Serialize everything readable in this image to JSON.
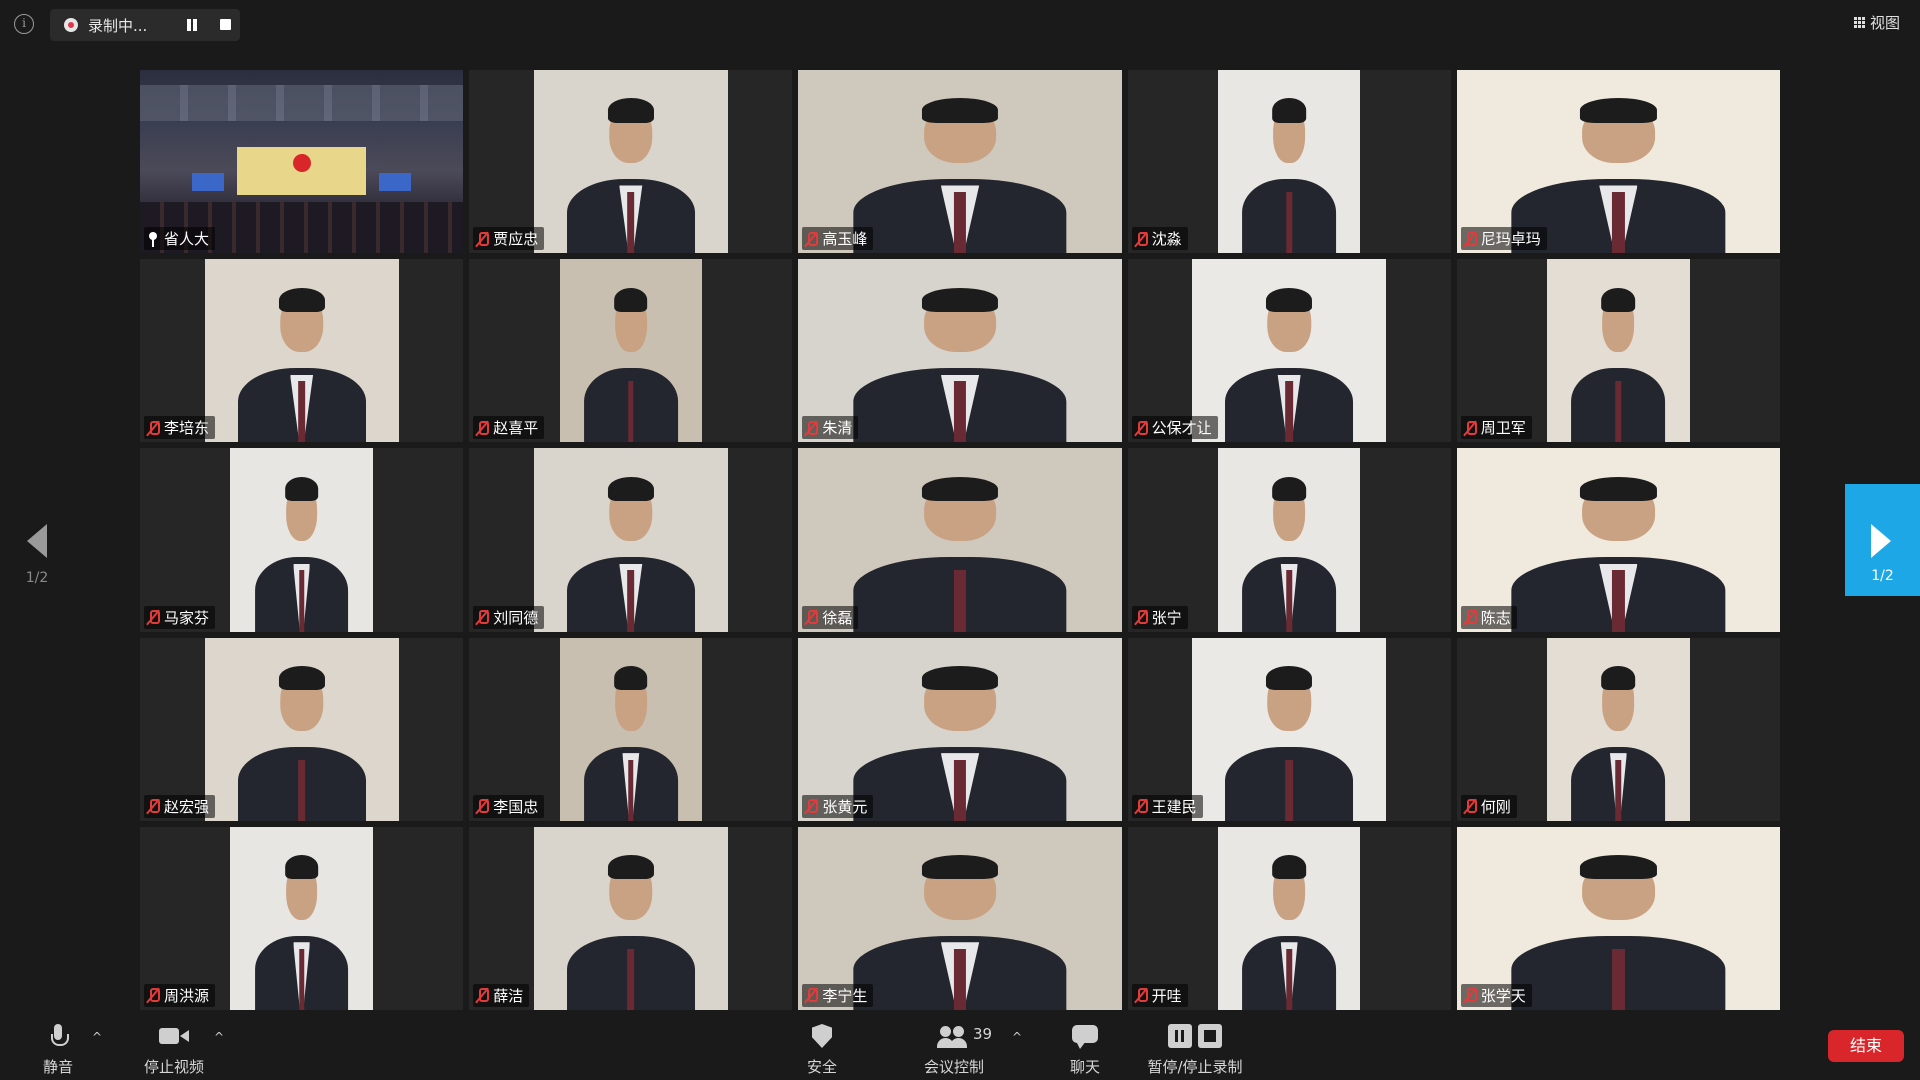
{
  "top_bar": {
    "recording_label": "录制中...",
    "view_label": "视图"
  },
  "navigation": {
    "left_page": "1/2",
    "right_page": "1/2"
  },
  "participants": [
    {
      "name": "省人大",
      "muted": false
    },
    {
      "name": "贾应忠",
      "muted": true
    },
    {
      "name": "高玉峰",
      "muted": true
    },
    {
      "name": "沈淼",
      "muted": true
    },
    {
      "name": "尼玛卓玛",
      "muted": true
    },
    {
      "name": "李培东",
      "muted": true
    },
    {
      "name": "赵喜平",
      "muted": true
    },
    {
      "name": "朱清",
      "muted": true
    },
    {
      "name": "公保才让",
      "muted": true
    },
    {
      "name": "周卫军",
      "muted": true
    },
    {
      "name": "马家芬",
      "muted": true
    },
    {
      "name": "刘同德",
      "muted": true
    },
    {
      "name": "徐磊",
      "muted": true
    },
    {
      "name": "张宁",
      "muted": true
    },
    {
      "name": "陈志",
      "muted": true
    },
    {
      "name": "赵宏强",
      "muted": true
    },
    {
      "name": "李国忠",
      "muted": true
    },
    {
      "name": "张黄元",
      "muted": true
    },
    {
      "name": "王建民",
      "muted": true
    },
    {
      "name": "何刚",
      "muted": true
    },
    {
      "name": "周洪源",
      "muted": true
    },
    {
      "name": "薛洁",
      "muted": true
    },
    {
      "name": "李宁生",
      "muted": true
    },
    {
      "name": "开哇",
      "muted": true
    },
    {
      "name": "张学天",
      "muted": true
    }
  ],
  "toolbar": {
    "mute_label": "静音",
    "stop_video_label": "停止视频",
    "security_label": "安全",
    "participants_label": "会议控制",
    "participant_count": "39",
    "chat_label": "聊天",
    "record_label": "暂停/停止录制",
    "end_label": "结束"
  },
  "colors": {
    "active_speaker_border": "#c9ef4a",
    "nav_accent": "#1ea7e7",
    "end_button": "#d8262a",
    "muted_icon": "#e33a3a"
  }
}
